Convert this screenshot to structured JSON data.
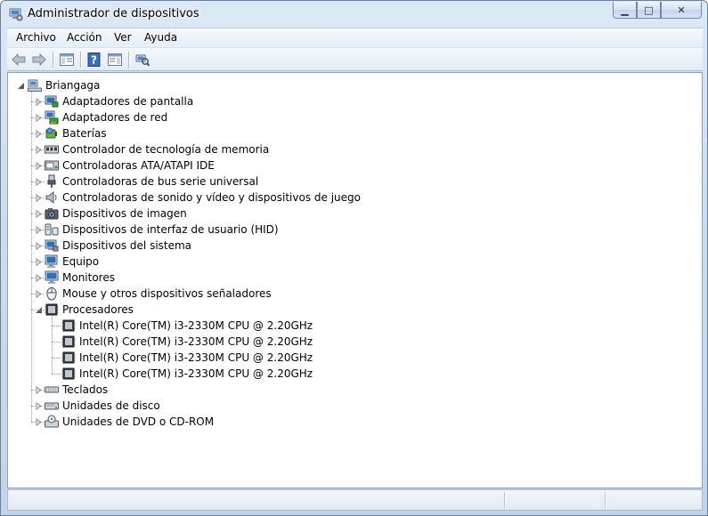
{
  "window": {
    "title": "Administrador de dispositivos",
    "minimize_glyph": "▁",
    "maximize_glyph": "□",
    "close_glyph": "✕"
  },
  "menu": {
    "items": [
      "Archivo",
      "Acción",
      "Ver",
      "Ayuda"
    ]
  },
  "toolbar": {
    "buttons": [
      "back-arrow-icon",
      "forward-arrow-icon",
      "properties-pane-icon",
      "help-icon",
      "details-pane-icon",
      "scan-hardware-icon"
    ]
  },
  "tree": {
    "root": "Briangaga",
    "categories": [
      {
        "label": "Adaptadores de pantalla",
        "icon": "display-adapter-icon"
      },
      {
        "label": "Adaptadores de red",
        "icon": "network-adapter-icon"
      },
      {
        "label": "Baterías",
        "icon": "battery-icon"
      },
      {
        "label": "Controlador de tecnología de memoria",
        "icon": "memory-controller-icon"
      },
      {
        "label": "Controladoras ATA/ATAPI IDE",
        "icon": "ide-controller-icon"
      },
      {
        "label": "Controladoras de bus serie universal",
        "icon": "usb-icon"
      },
      {
        "label": "Controladoras de sonido y vídeo y dispositivos de juego",
        "icon": "speaker-icon"
      },
      {
        "label": "Dispositivos de imagen",
        "icon": "camera-icon"
      },
      {
        "label": "Dispositivos de interfaz de usuario (HID)",
        "icon": "hid-icon"
      },
      {
        "label": "Dispositivos del sistema",
        "icon": "system-device-icon"
      },
      {
        "label": "Equipo",
        "icon": "computer-icon"
      },
      {
        "label": "Monitores",
        "icon": "monitor-icon"
      },
      {
        "label": "Mouse y otros dispositivos señaladores",
        "icon": "mouse-icon"
      },
      {
        "label": "Procesadores",
        "icon": "processor-icon",
        "expanded": true,
        "children": [
          "Intel(R) Core(TM) i3-2330M CPU @ 2.20GHz",
          "Intel(R) Core(TM) i3-2330M CPU @ 2.20GHz",
          "Intel(R) Core(TM) i3-2330M CPU @ 2.20GHz",
          "Intel(R) Core(TM) i3-2330M CPU @ 2.20GHz"
        ]
      },
      {
        "label": "Teclados",
        "icon": "keyboard-icon"
      },
      {
        "label": "Unidades de disco",
        "icon": "disk-drive-icon"
      },
      {
        "label": "Unidades de DVD o CD-ROM",
        "icon": "dvd-drive-icon"
      }
    ]
  },
  "colors": {
    "accent": "#3c7fb1",
    "frame": "#cddcee"
  }
}
